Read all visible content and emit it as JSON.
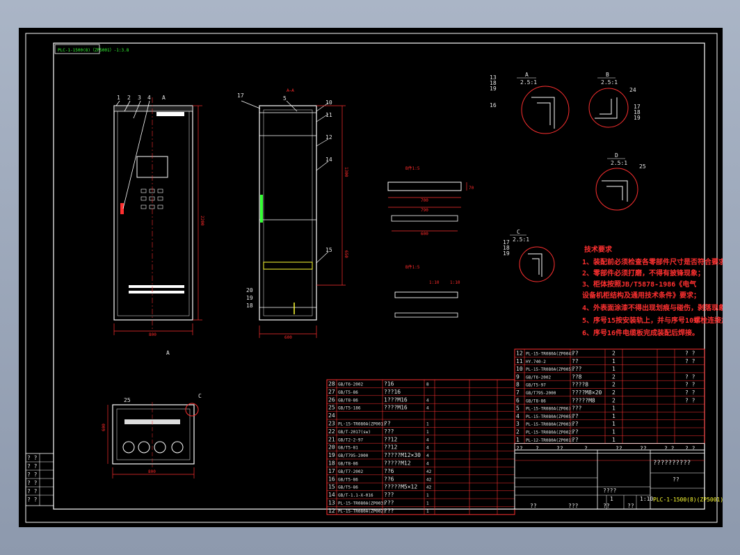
{
  "colors": {
    "background": "#000000",
    "frame": "#ffffff",
    "dimension": "#ff2a2a",
    "text": "#e8e8e8",
    "highlight": "#ffff33",
    "label": "#33ff33",
    "window": "#9aa7bb"
  },
  "drawing": {
    "header_tag": "PLC-1-1500(8)（ZP5001）-1:3.8",
    "title_main": "??????????",
    "title_sub": "??",
    "drawing_code": "PLC-1-1500(8)(ZP5001)",
    "company_label": "??",
    "row_marks": [
      "? ?",
      "? ?",
      "? ?",
      "? ?",
      "? ?",
      "? ?"
    ]
  },
  "views": {
    "front": {
      "balloons": [
        "1",
        "2",
        "3",
        "4"
      ],
      "section_mark": "A",
      "width_dim": "800",
      "height_dim": "2200"
    },
    "section": {
      "title": "A—A",
      "balloons": [
        "17",
        "5",
        "10",
        "11",
        "12",
        "14",
        "15",
        "20",
        "19",
        "18"
      ],
      "width_dim": "600",
      "height_dims": [
        "2200",
        "1300",
        "650"
      ]
    },
    "bracket_top": {
      "title": "B件1:5",
      "dims": [
        "700",
        "790",
        "600",
        "70"
      ]
    },
    "bracket_low": {
      "title": "B件1:5",
      "dims": [
        "1:10",
        "1:10"
      ]
    },
    "plan": {
      "balloons": [
        "25"
      ],
      "section_mark": "C",
      "width_dim": "800",
      "depth_dim": "600"
    },
    "detail_a": {
      "letter": "A",
      "scale": "2.5:1",
      "balloons": [
        "13",
        "18",
        "19",
        "16"
      ]
    },
    "detail_b": {
      "letter": "B",
      "scale": "2.5:1",
      "balloons": [
        "24",
        "17",
        "18",
        "19"
      ]
    },
    "detail_c": {
      "letter": "C",
      "scale": "2.5:1",
      "balloons": [
        "17",
        "18",
        "19"
      ]
    },
    "detail_d": {
      "letter": "D",
      "scale": "2.5:1",
      "balloons": [
        "25"
      ]
    }
  },
  "notes": {
    "title": "技术要求",
    "items": [
      "1、装配前必须检查各零部件尺寸是否符合要求；",
      "2、零部件必须打磨，不得有披锋现象；",
      "3、柜体按照JB/T5878-1986《电气",
      "   设备机柜结构及通用技术条件》要求；",
      "4、外表面涂漆不得出现划痕与碰伤，剥落现象；",
      "5、序号15按安装轨上，并与序号10螺栓连接加固；",
      "6、序号16件电缆板完成装配后焊接。"
    ]
  },
  "bom_left": [
    {
      "no": "28",
      "code": "GB/T6-2002",
      "name": "?16",
      "qty": "8"
    },
    {
      "no": "27",
      "code": "GB/T5-86",
      "name": "???16",
      "qty": ""
    },
    {
      "no": "26",
      "code": "GB/T8-86",
      "name": "1???M16",
      "qty": "4"
    },
    {
      "no": "25",
      "code": "GB/T5-186",
      "name": "????M16",
      "qty": "4"
    },
    {
      "no": "24",
      "code": "",
      "name": "",
      "qty": ""
    },
    {
      "no": "23",
      "code": "PL-15-TR080A(ZP001)",
      "name": "??",
      "qty": "1"
    },
    {
      "no": "22",
      "code": "GB/T-2017(sw)",
      "name": "???",
      "qty": "1"
    },
    {
      "no": "21",
      "code": "GB/T2-2-97",
      "name": "??12",
      "qty": "4"
    },
    {
      "no": "20",
      "code": "GB/T5-81",
      "name": "??12",
      "qty": "4"
    },
    {
      "no": "19",
      "code": "GB/T795-2000",
      "name": "?????M12×30",
      "qty": "4"
    },
    {
      "no": "18",
      "code": "GB/T8-86",
      "name": "?????M12",
      "qty": "4"
    },
    {
      "no": "17",
      "code": "GB/T7-2002",
      "name": "??6",
      "qty": "42"
    },
    {
      "no": "16",
      "code": "GB/T5-86",
      "name": "??6",
      "qty": "42"
    },
    {
      "no": "15",
      "code": "GB/T5-86",
      "name": "?????M5×12",
      "qty": "42"
    },
    {
      "no": "14",
      "code": "GB/T-1.1-X-016",
      "name": "???",
      "qty": "1"
    },
    {
      "no": "13",
      "code": "PL-15-TR080A(ZP003)",
      "name": "???",
      "qty": "1"
    },
    {
      "no": "12",
      "code": "PL-15-TR080A(ZP002)",
      "name": "???",
      "qty": "1"
    }
  ],
  "bom_right": [
    {
      "no": "12",
      "code": "PL-15-TR080A(ZP004)",
      "name": "??",
      "qty": "2",
      "mass": "? ?"
    },
    {
      "no": "11",
      "code": "HY.740-2",
      "name": "??",
      "qty": "1",
      "mass": "? ?"
    },
    {
      "no": "10",
      "code": "PL-15-TR080A(ZP005)",
      "name": "???",
      "qty": "1",
      "mass": ""
    },
    {
      "no": "9",
      "code": "GB/T6-2002",
      "name": "??8",
      "qty": "2",
      "mass": "? ?"
    },
    {
      "no": "8",
      "code": "GB/T5-97",
      "name": "????8",
      "qty": "2",
      "mass": "? ?"
    },
    {
      "no": "7",
      "code": "GB/T795-2000",
      "name": "????M8×20",
      "qty": "2",
      "mass": "? ?"
    },
    {
      "no": "6",
      "code": "GB/T8-86",
      "name": "?????M8",
      "qty": "2",
      "mass": "? ?"
    },
    {
      "no": "5",
      "code": "PL-15-TR080A(ZP06)",
      "name": "???",
      "qty": "1",
      "mass": ""
    },
    {
      "no": "4",
      "code": "PL-15-TR080A(ZP005)",
      "name": "??",
      "qty": "1",
      "mass": ""
    },
    {
      "no": "3",
      "code": "PL-15-TR080A(ZP003)",
      "name": "??",
      "qty": "1",
      "mass": ""
    },
    {
      "no": "2",
      "code": "PL-15-TR080A(ZP002)",
      "name": "??",
      "qty": "1",
      "mass": ""
    },
    {
      "no": "1",
      "code": "PL-12-TR080A(ZP001)",
      "name": "??",
      "qty": "1",
      "mass": ""
    }
  ],
  "bom_header": [
    "??",
    "?",
    "??",
    "?",
    "??",
    "??",
    "? ?",
    "? ?"
  ],
  "title_block": {
    "scale": "1:10",
    "sheet": "1",
    "weight": "????",
    "labels": [
      "??",
      "???",
      "??",
      "??"
    ]
  }
}
